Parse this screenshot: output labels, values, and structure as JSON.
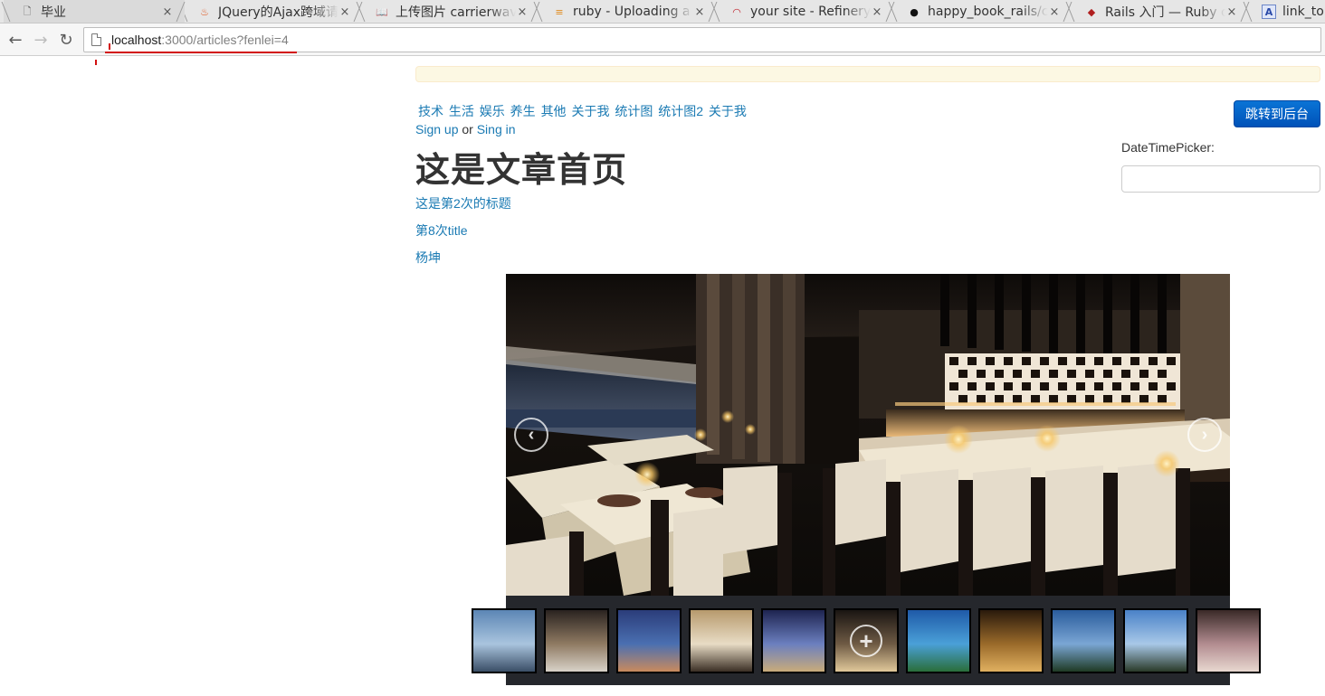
{
  "browser": {
    "tabs": [
      {
        "title": "毕业",
        "icon": "page-icon",
        "active": true
      },
      {
        "title": "JQuery的Ajax跨域请求",
        "icon": "flame-icon",
        "active": false
      },
      {
        "title": "上传图片 carrierwave",
        "icon": "book-icon",
        "active": false
      },
      {
        "title": "ruby - Uploading a f",
        "icon": "stack-icon",
        "active": false
      },
      {
        "title": "your site - Refinery",
        "icon": "refinery-icon",
        "active": false
      },
      {
        "title": "happy_book_rails/c",
        "icon": "github-icon",
        "active": false
      },
      {
        "title": "Rails 入门 — Ruby o",
        "icon": "rails-icon",
        "active": false
      },
      {
        "title": "link_to (Ac",
        "icon": "a-icon",
        "active": false
      }
    ],
    "tab_close_glyph": "×",
    "nav": {
      "back": "←",
      "forward": "→",
      "reload": "↻"
    },
    "url": {
      "host": "localhost",
      "rest": ":3000/articles?",
      "query": "fenlei=4"
    }
  },
  "page": {
    "categories": [
      "技术",
      "生活",
      "娱乐",
      "养生",
      "其他",
      "关于我",
      "统计图",
      "统计图2",
      "关于我"
    ],
    "auth": {
      "sign_up": "Sign up",
      "or": "or",
      "sign_in": "Sing in"
    },
    "heading": "这是文章首页",
    "articles": [
      "这是第2次的标题",
      "第8次title",
      "杨坤"
    ],
    "admin_button": "跳转到后台",
    "datetimepicker_label": "DateTimePicker:",
    "datetimepicker_value": "",
    "carousel": {
      "prev_glyph": "‹",
      "next_glyph": "›",
      "zoom_glyph": "+",
      "thumbnails": [
        {
          "name": "thumb-ocean-edge",
          "colors": [
            "#5c86b5",
            "#a9c4de",
            "#3a4e66"
          ]
        },
        {
          "name": "thumb-pavilion",
          "colors": [
            "#2a2320",
            "#8f7a62",
            "#d8d2c8"
          ]
        },
        {
          "name": "thumb-sunset-sea",
          "colors": [
            "#2b3d7a",
            "#4a6fb1",
            "#c98a5d"
          ]
        },
        {
          "name": "thumb-bedroom",
          "colors": [
            "#b79a6d",
            "#e8dcc5",
            "#3b2f25"
          ]
        },
        {
          "name": "thumb-night-terrace",
          "colors": [
            "#1e2450",
            "#6b7fbf",
            "#c9ab7a"
          ]
        },
        {
          "name": "thumb-restaurant",
          "colors": [
            "#1a1512",
            "#6e5a44",
            "#e0c89a"
          ]
        },
        {
          "name": "thumb-pool-dusk",
          "colors": [
            "#1f5aa8",
            "#4aa0d8",
            "#2a6e3a"
          ]
        },
        {
          "name": "thumb-lobby",
          "colors": [
            "#2a1a0c",
            "#9a6a2a",
            "#e0b060"
          ]
        },
        {
          "name": "thumb-resort-blue",
          "colors": [
            "#2a5c9c",
            "#7aa6d4",
            "#1f3a24"
          ]
        },
        {
          "name": "thumb-palm-beach",
          "colors": [
            "#4a82c8",
            "#a8c8e8",
            "#2a3a28"
          ]
        },
        {
          "name": "thumb-interior-edge",
          "colors": [
            "#3a2a28",
            "#b28c90",
            "#e8d8d0"
          ]
        }
      ]
    }
  }
}
